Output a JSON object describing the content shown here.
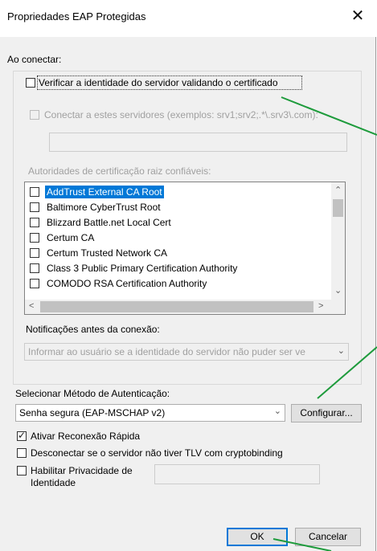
{
  "window": {
    "title": "Propriedades EAP Protegidas",
    "close_glyph": "✕"
  },
  "on_connect": {
    "label": "Ao conectar:",
    "verify_checkbox": "Verificar a identidade do servidor validando o certificado",
    "connect_servers": "Conectar a estes servidores (exemplos: srv1;srv2;.*\\.srv3\\.com):",
    "servers_value": "",
    "trusted_roots_label": "Autoridades de certificação raiz confiáveis:",
    "certificates": [
      "AddTrust External CA Root",
      "Baltimore CyberTrust Root",
      "Blizzard Battle.net Local Cert",
      "Certum CA",
      "Certum Trusted Network CA",
      "Class 3 Public Primary Certification Authority",
      "COMODO RSA Certification Authority"
    ],
    "notifications_label": "Notificações antes da conexão:",
    "notifications_value": "Informar ao usuário se a identidade do servidor não puder ser ve"
  },
  "auth": {
    "label": "Selecionar Método de Autenticação:",
    "method_value": "Senha segura (EAP-MSCHAP v2)",
    "configure_button": "Configurar..."
  },
  "options": {
    "fast_reconnect": "Ativar Reconexão Rápida",
    "disconnect_tlv": "Desconectar se o servidor não tiver TLV com cryptobinding",
    "privacy_line1": "Habilitar Privacidade de",
    "privacy_line2": "Identidade",
    "privacy_value": ""
  },
  "buttons": {
    "ok": "OK",
    "cancel": "Cancelar"
  },
  "colors": {
    "selection": "#0078d7",
    "annotation_arrow": "#1e9b3c"
  }
}
